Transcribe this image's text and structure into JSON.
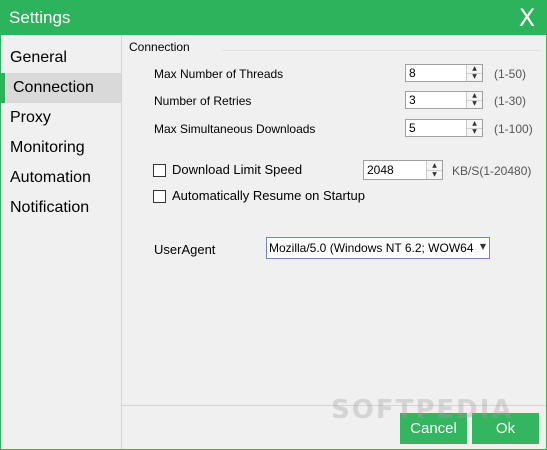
{
  "window": {
    "title": "Settings",
    "close_glyph": "X"
  },
  "sidebar": {
    "items": [
      {
        "label": "General"
      },
      {
        "label": "Connection"
      },
      {
        "label": "Proxy"
      },
      {
        "label": "Monitoring"
      },
      {
        "label": "Automation"
      },
      {
        "label": "Notification"
      }
    ],
    "active": "Connection"
  },
  "connection": {
    "section_title": "Connection",
    "max_threads": {
      "label": "Max Number of Threads",
      "value": "8",
      "range": "(1-50)"
    },
    "retries": {
      "label": "Number of Retries",
      "value": "3",
      "range": "(1-30)"
    },
    "max_downloads": {
      "label": "Max Simultaneous Downloads",
      "value": "5",
      "range": "(1-100)"
    },
    "limit_speed": {
      "label": "Download Limit Speed",
      "checked": false,
      "value": "2048",
      "unit": "KB/S(1-20480)"
    },
    "auto_resume": {
      "label": "Automatically Resume on Startup",
      "checked": false
    },
    "useragent": {
      "label": "UserAgent",
      "value": "Mozilla/5.0 (Windows NT 6.2; WOW64"
    }
  },
  "footer": {
    "cancel_label": "Cancel",
    "ok_label": "Ok"
  },
  "watermark": "SOFTPEDIA",
  "colors": {
    "accent": "#2db35b",
    "button": "#34b560",
    "panel": "#f0f0f0"
  },
  "icons": {
    "spin_up": "spin-up-arrow-icon",
    "spin_down": "spin-down-arrow-icon",
    "dropdown": "dropdown-caret-icon",
    "close": "close-icon"
  }
}
